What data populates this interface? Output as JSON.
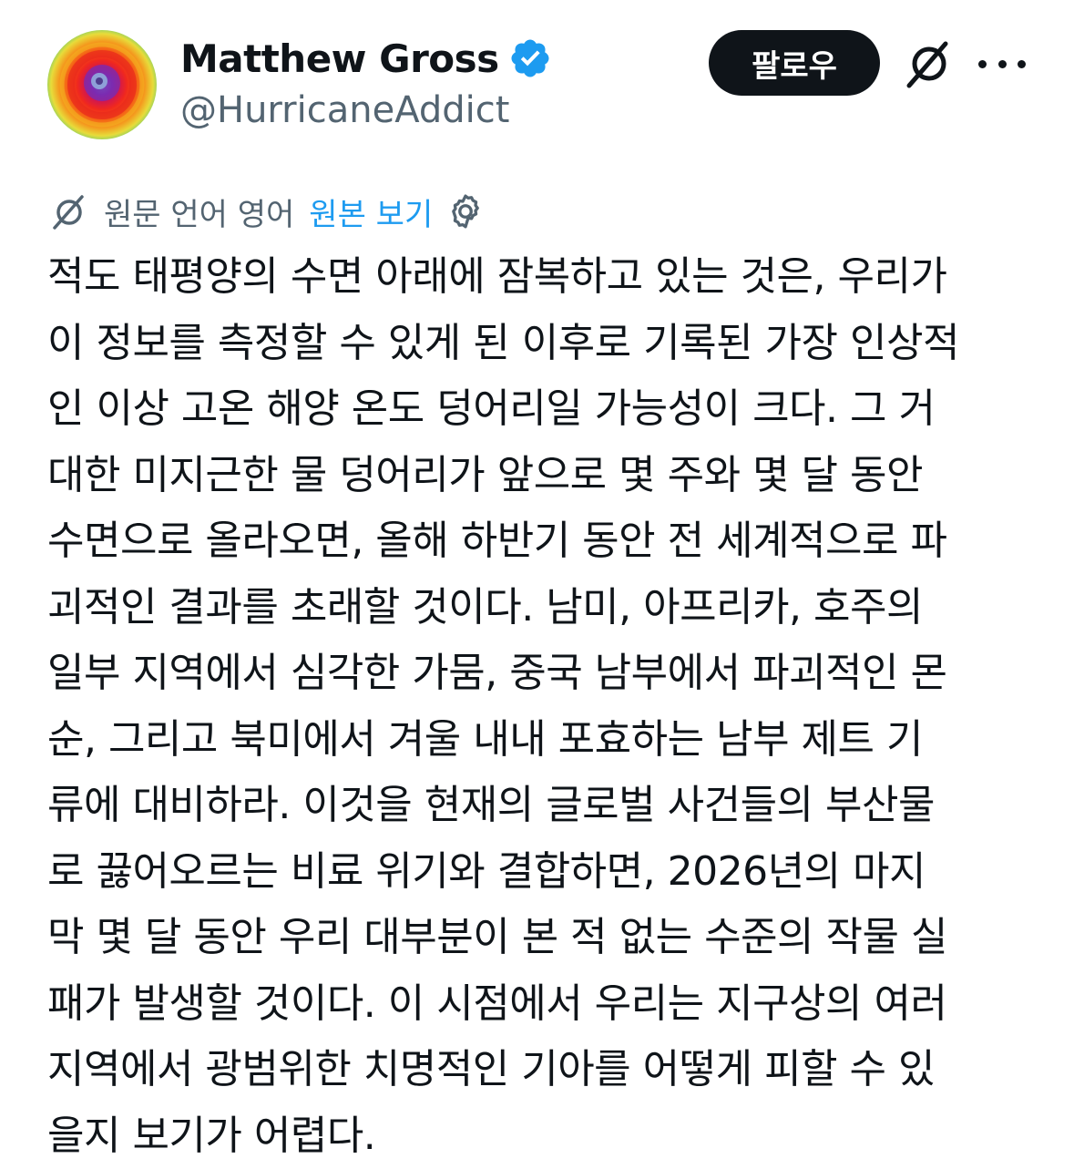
{
  "header": {
    "display_name": "Matthew Gross",
    "handle": "@HurricaneAddict",
    "follow_label": "팔로우",
    "verified_badge": "verified-badge-icon",
    "accent_color": "#1d9bf0"
  },
  "translation": {
    "label": "원문 언어 영어",
    "show_original": "원본 보기"
  },
  "tweet": {
    "lines": [
      "적도 태평양의 수면 아래에 잠복하고 있는 것은, 우리가",
      "이 정보를 측정할 수 있게 된 이후로 기록된 가장 인상적",
      "인 이상 고온 해양 온도 덩어리일 가능성이 크다. 그 거",
      "대한 미지근한 물 덩어리가 앞으로 몇 주와 몇 달 동안",
      "수면으로 올라오면, 올해 하반기 동안 전 세계적으로 파",
      "괴적인 결과를 초래할 것이다. 남미, 아프리카, 호주의",
      "일부 지역에서 심각한 가뭄, 중국 남부에서 파괴적인 몬",
      "순, 그리고 북미에서 겨울 내내 포효하는 남부 제트 기",
      "류에 대비하라. 이것을 현재의 글로벌 사건들의 부산물",
      "로 끓어오르는 비료 위기와 결합하면, 2026년의 마지",
      "막 몇 달 동안 우리 대부분이 본 적 없는 수준의 작물 실",
      "패가 발생할 것이다. 이 시점에서 우리는 지구상의 여러",
      "지역에서 광범위한 치명적인 기아를 어떻게 피할 수 있",
      "을지 보기가 어렵다."
    ]
  }
}
